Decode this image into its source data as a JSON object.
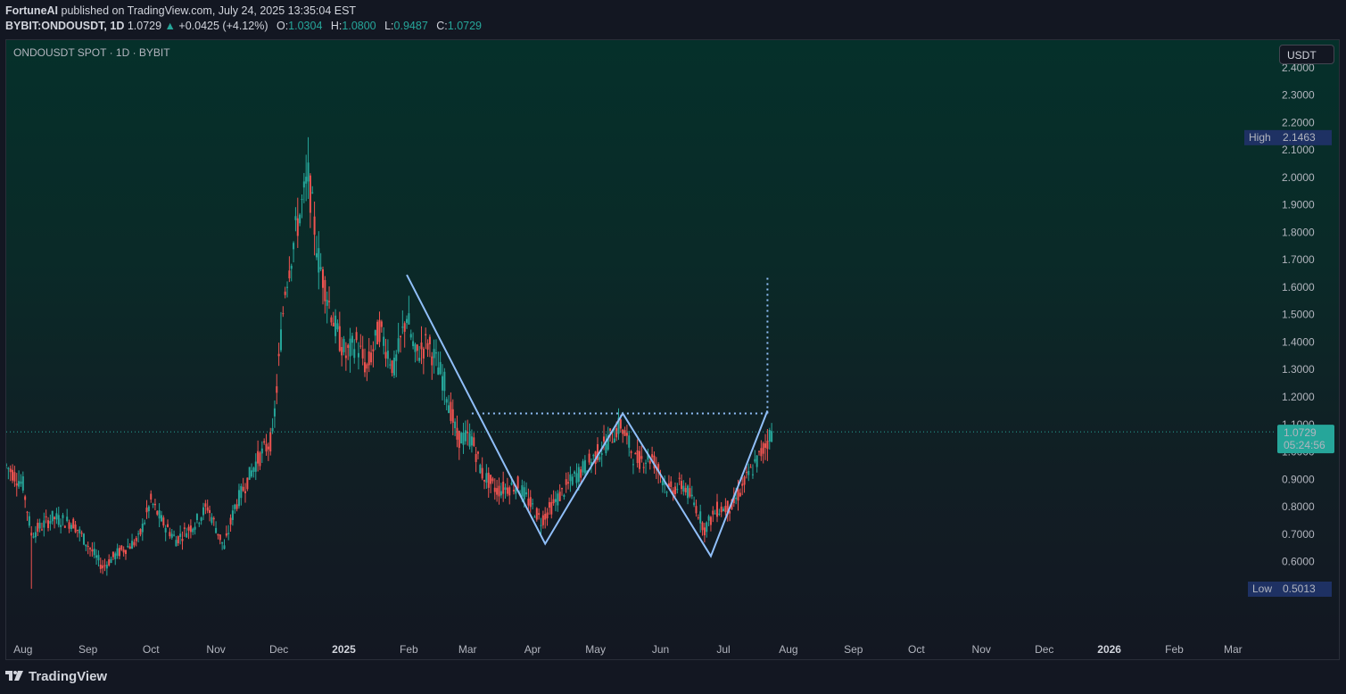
{
  "header": {
    "author": "FortuneAI",
    "published": "published on TradingView.com, July 24, 2025 13:35:04 EST",
    "symbol": "BYBIT:ONDOUSDT, 1D",
    "last": "1.0729",
    "change_arrow": "▲",
    "change": "+0.0425 (+4.12%)",
    "o_label": "O:",
    "o_value": "1.0304",
    "h_label": "H:",
    "h_value": "1.0800",
    "l_label": "L:",
    "l_value": "0.9487",
    "c_label": "C:",
    "c_value": "1.0729"
  },
  "legend": "ONDOUSDT SPOT · 1D · BYBIT",
  "currency_button": "USDT",
  "footer": {
    "brand": "TradingView",
    "logo_icon": "tradingview-logo-icon"
  },
  "colors": {
    "up": "#26a69a",
    "down": "#ef5350",
    "pattern": "#90bff9",
    "badge_bg": "#1e3163",
    "price_bg": "#26a69a"
  },
  "chart_data": {
    "type": "candlestick",
    "title": "ONDOUSDT SPOT · 1D · BYBIT",
    "y_axis": {
      "ticks": [
        "0.6000",
        "0.7000",
        "0.8000",
        "0.9000",
        "1.0000",
        "1.1000",
        "1.2000",
        "1.3000",
        "1.4000",
        "1.5000",
        "1.6000",
        "1.7000",
        "1.8000",
        "1.9000",
        "2.0000",
        "2.1000",
        "2.2000",
        "2.3000",
        "2.4000"
      ],
      "range": [
        0.42,
        2.5
      ]
    },
    "x_axis": {
      "labels": [
        "Aug",
        "Sep",
        "Oct",
        "Nov",
        "Dec",
        "2025",
        "Feb",
        "Mar",
        "Apr",
        "May",
        "Jun",
        "Jul",
        "Aug",
        "Sep",
        "Oct",
        "Nov",
        "Dec",
        "2026",
        "Feb",
        "Mar"
      ],
      "year_labels": [
        "2025",
        "2026"
      ],
      "range": [
        "2024-07-24",
        "2026-03-20"
      ]
    },
    "price_path": [
      [
        "2024-07-24",
        0.95
      ],
      [
        "2024-08-01",
        0.88
      ],
      [
        "2024-08-05",
        0.7
      ],
      [
        "2024-08-15",
        0.76
      ],
      [
        "2024-08-25",
        0.74
      ],
      [
        "2024-09-01",
        0.66
      ],
      [
        "2024-09-08",
        0.58
      ],
      [
        "2024-09-15",
        0.63
      ],
      [
        "2024-09-25",
        0.68
      ],
      [
        "2024-10-01",
        0.82
      ],
      [
        "2024-10-06",
        0.75
      ],
      [
        "2024-10-13",
        0.68
      ],
      [
        "2024-10-22",
        0.74
      ],
      [
        "2024-10-28",
        0.8
      ],
      [
        "2024-11-05",
        0.65
      ],
      [
        "2024-11-10",
        0.8
      ],
      [
        "2024-11-20",
        0.96
      ],
      [
        "2024-11-28",
        1.05
      ],
      [
        "2024-12-04",
        1.6
      ],
      [
        "2024-12-09",
        1.8
      ],
      [
        "2024-12-15",
        2.0
      ],
      [
        "2024-12-20",
        1.7
      ],
      [
        "2024-12-28",
        1.45
      ],
      [
        "2025-01-02",
        1.35
      ],
      [
        "2025-01-07",
        1.4
      ],
      [
        "2025-01-12",
        1.3
      ],
      [
        "2025-01-18",
        1.45
      ],
      [
        "2025-01-25",
        1.3
      ],
      [
        "2025-01-31",
        1.5
      ],
      [
        "2025-02-04",
        1.35
      ],
      [
        "2025-02-10",
        1.4
      ],
      [
        "2025-02-18",
        1.25
      ],
      [
        "2025-02-24",
        1.05
      ],
      [
        "2025-03-03",
        1.05
      ],
      [
        "2025-03-08",
        0.92
      ],
      [
        "2025-03-15",
        0.86
      ],
      [
        "2025-03-25",
        0.88
      ],
      [
        "2025-04-05",
        0.75
      ],
      [
        "2025-04-12",
        0.82
      ],
      [
        "2025-04-20",
        0.9
      ],
      [
        "2025-04-28",
        0.96
      ],
      [
        "2025-05-05",
        1.02
      ],
      [
        "2025-05-13",
        1.1
      ],
      [
        "2025-05-20",
        0.97
      ],
      [
        "2025-05-28",
        0.98
      ],
      [
        "2025-06-05",
        0.86
      ],
      [
        "2025-06-12",
        0.88
      ],
      [
        "2025-06-18",
        0.8
      ],
      [
        "2025-06-22",
        0.72
      ],
      [
        "2025-06-28",
        0.79
      ],
      [
        "2025-07-05",
        0.8
      ],
      [
        "2025-07-12",
        0.9
      ],
      [
        "2025-07-18",
        0.98
      ],
      [
        "2025-07-24",
        1.0729
      ]
    ],
    "overlays": {
      "pattern_path": [
        [
          "2025-01-31",
          1.645
        ],
        [
          "2025-04-07",
          0.665
        ],
        [
          "2025-05-14",
          1.14
        ],
        [
          "2025-06-25",
          0.62
        ],
        [
          "2025-07-22",
          1.15
        ]
      ],
      "neckline": {
        "x_from": "2025-03-03",
        "x_to": "2025-07-22",
        "y": 1.14
      },
      "target_line": {
        "x": "2025-07-22",
        "y_from": 1.14,
        "y_to": 1.64
      }
    },
    "last_price": {
      "value": "1.0729",
      "countdown": "05:24:56"
    },
    "high": {
      "label": "High",
      "value": "2.1463"
    },
    "low": {
      "label": "Low",
      "value": "0.5013"
    },
    "grid": false,
    "legend": "top-left"
  }
}
